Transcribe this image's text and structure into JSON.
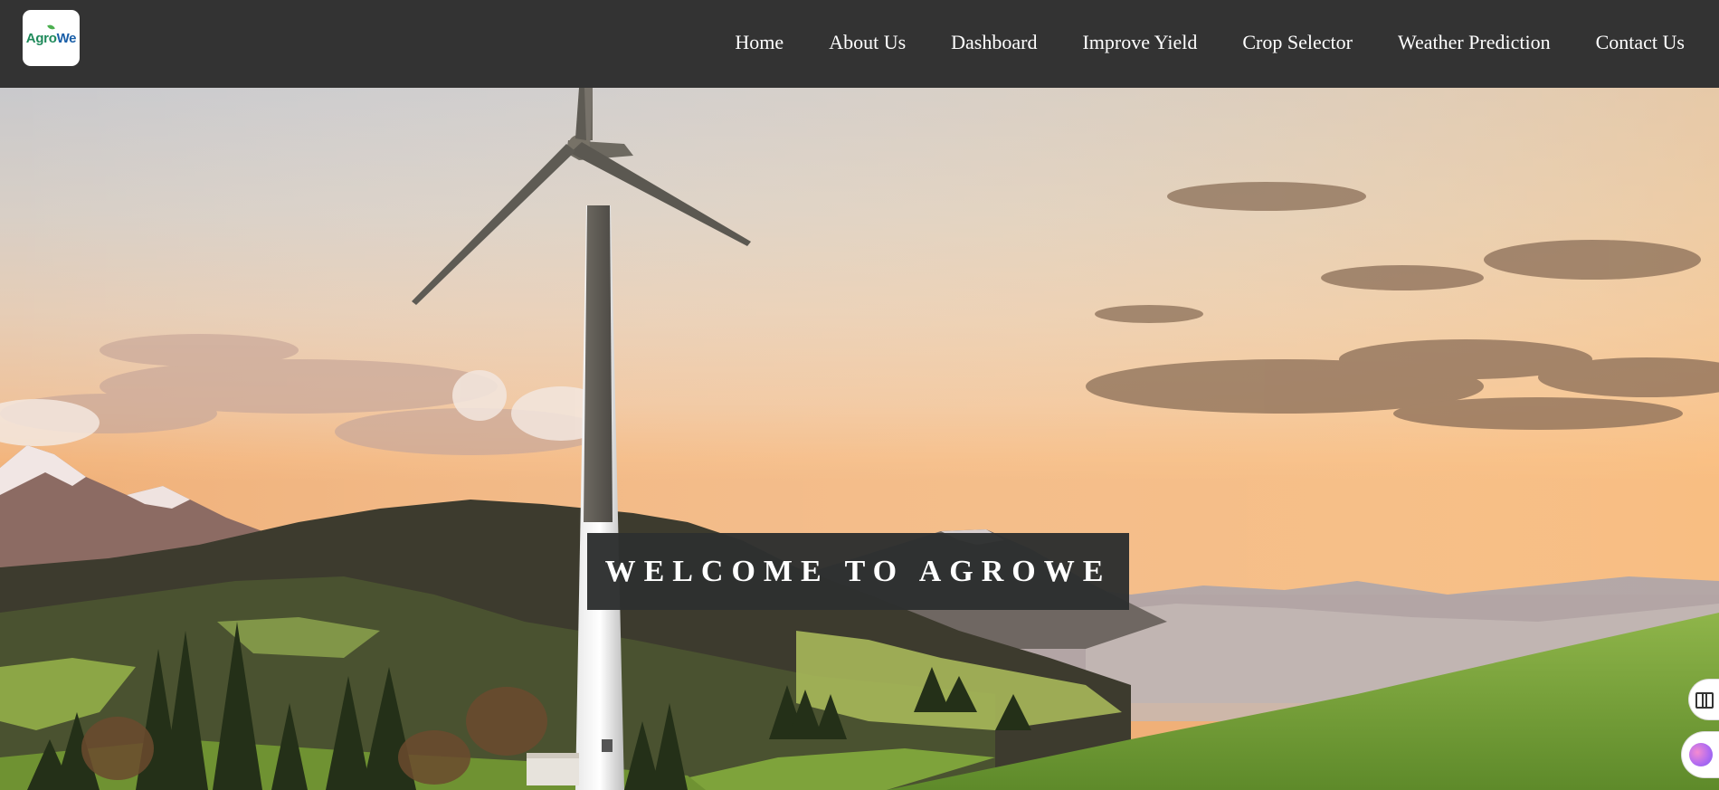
{
  "header": {
    "logo": {
      "text_agro": "Agro",
      "text_we": "We"
    },
    "nav": [
      {
        "label": "Home"
      },
      {
        "label": "About Us"
      },
      {
        "label": "Dashboard"
      },
      {
        "label": "Improve Yield"
      },
      {
        "label": "Crop Selector"
      },
      {
        "label": "Weather Prediction"
      },
      {
        "label": "Contact Us"
      }
    ]
  },
  "hero": {
    "welcome_text": "WELCOME TO AGROWE",
    "background_scene": "wind-turbine-mountain-sunset"
  },
  "widgets": {
    "reader_icon": "book-icon",
    "assistant_icon": "brain-icon"
  },
  "colors": {
    "navbar_bg": "#333333",
    "nav_text": "#ffffff",
    "welcome_box_bg": "#2d3030"
  }
}
